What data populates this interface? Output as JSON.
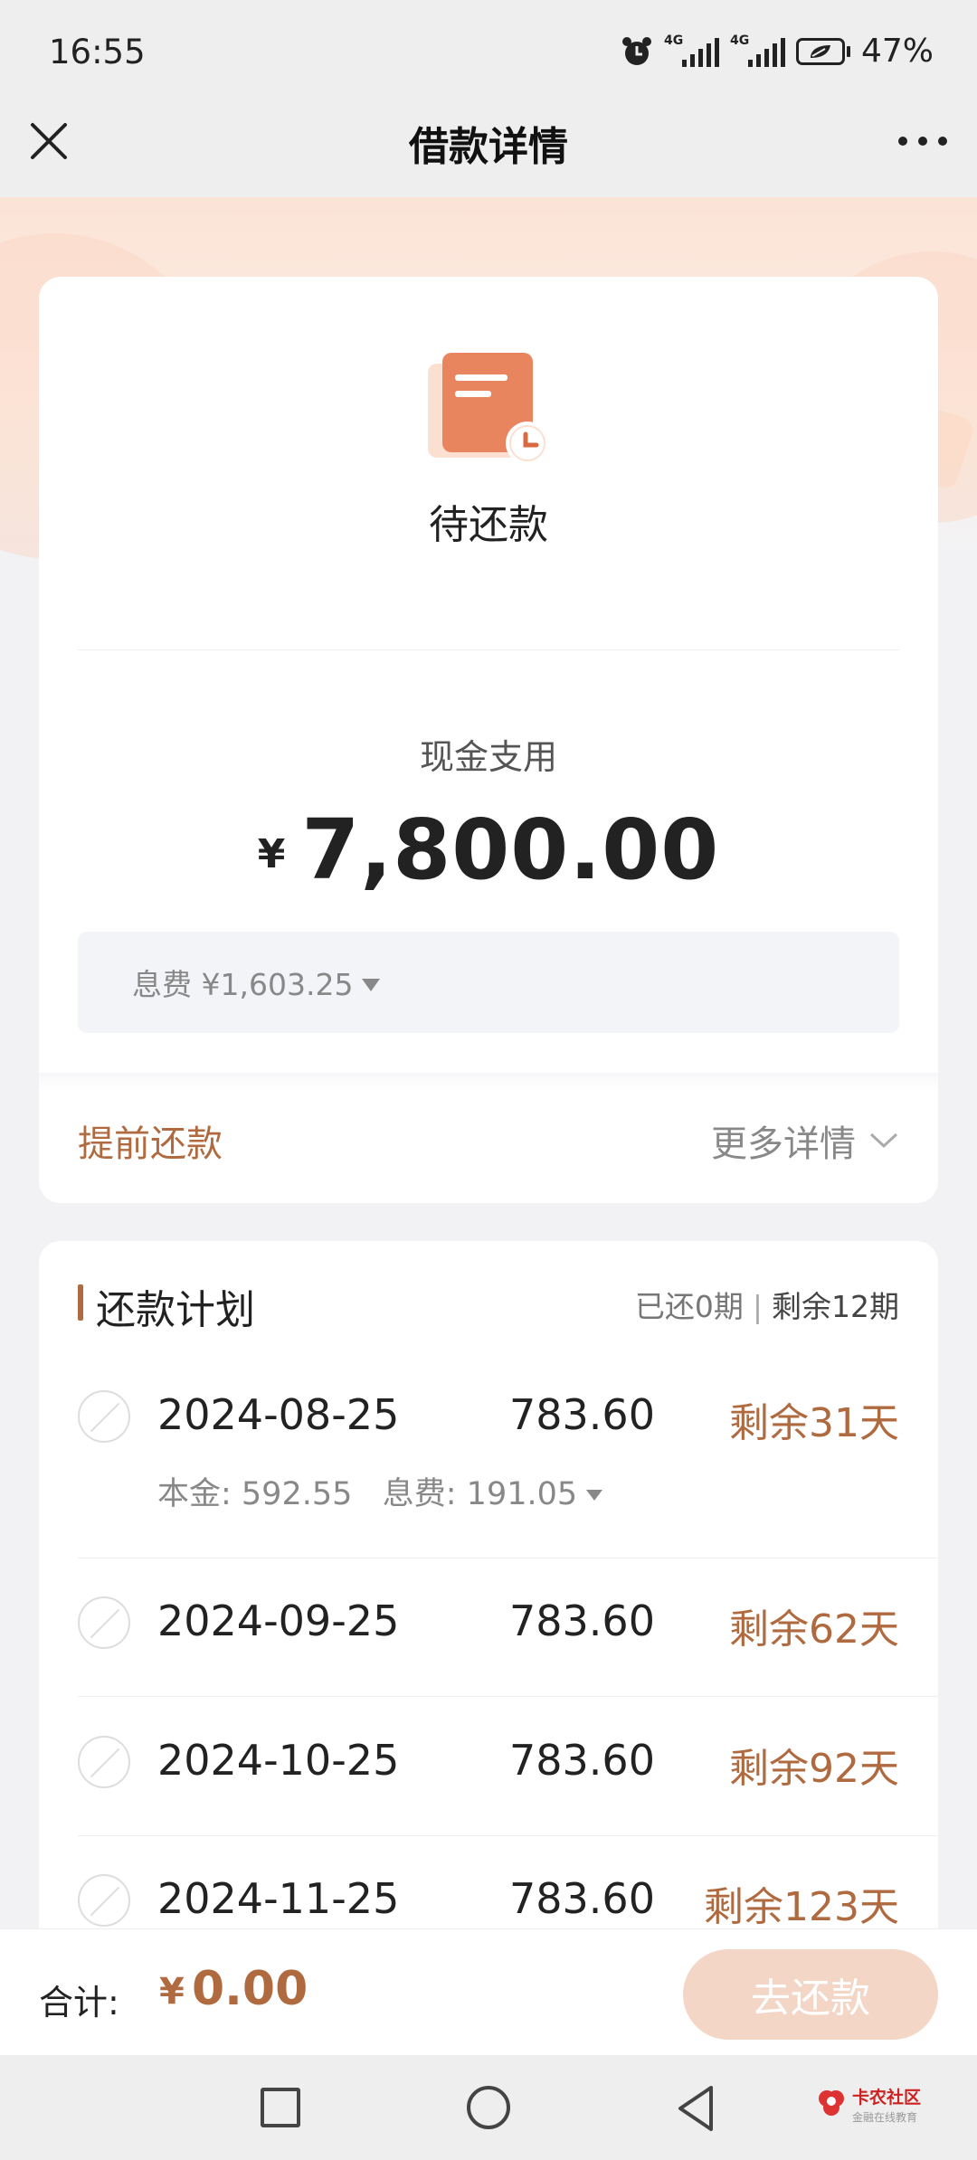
{
  "status_bar": {
    "time": "16:55",
    "battery": "47%",
    "network_1": "4G",
    "network_2": "4G"
  },
  "nav": {
    "title": "借款详情",
    "close_icon": "close-icon",
    "more_icon": "more-icon"
  },
  "loan": {
    "status": "待还款",
    "amount_label": "现金支用",
    "currency_symbol": "¥",
    "amount": "7,800.00",
    "fee": "息费 ¥1,603.25",
    "prepay_label": "提前还款",
    "more_label": "更多详情"
  },
  "plan": {
    "title": "还款计划",
    "paid": "已还0期",
    "remaining": "剩余12期",
    "rows": [
      {
        "date": "2024-08-25",
        "amount": "783.60",
        "days": "剩余31天",
        "detail": "本金: 592.55   息费: 191.05"
      },
      {
        "date": "2024-09-25",
        "amount": "783.60",
        "days": "剩余62天"
      },
      {
        "date": "2024-10-25",
        "amount": "783.60",
        "days": "剩余92天"
      },
      {
        "date": "2024-11-25",
        "amount": "783.60",
        "days": "剩余123天"
      }
    ]
  },
  "footer": {
    "total_label": "合计:",
    "currency_symbol": "¥",
    "total_amount": "0.00",
    "repay_button": "去还款"
  },
  "watermark": {
    "brand": "卡农社区",
    "tagline": "金融在线教育"
  },
  "colors": {
    "accent": "#b06a3f",
    "button_disabled": "#f3d6c6",
    "hero_gradient": "#fbe3d6"
  }
}
